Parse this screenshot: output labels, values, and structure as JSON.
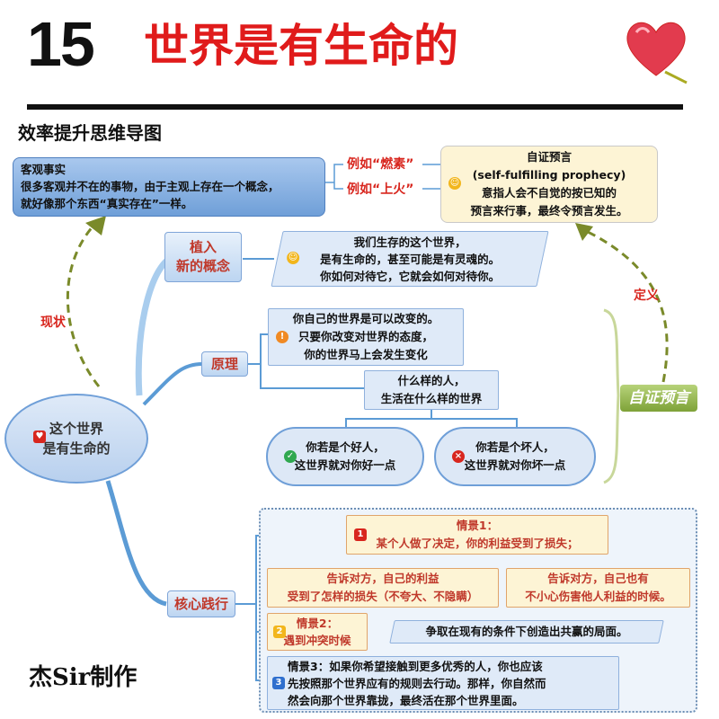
{
  "header": {
    "number": "15",
    "title": "世界是有生命的",
    "subtitle": "效率提升思维导图"
  },
  "footer": {
    "author": "杰Sir制作"
  },
  "center": {
    "line1": "这个世界",
    "line2": "是有生命的"
  },
  "objective_fact": {
    "line1": "客观事实",
    "line2": "很多客观并不在的事物，由于主观上存在一个概念，",
    "line3": "就好像那个东西“真实存在”一样。"
  },
  "examples": {
    "e1": "例如“燃素”",
    "e2": "例如“上火”"
  },
  "self_fulfilling": {
    "line1": "自证预言",
    "line2": "(self-fulfilling prophecy)",
    "line3": "意指人会不自觉的按已知的",
    "line4": "预言来行事，最终令预言发生。"
  },
  "labels": {
    "current": "现状",
    "definition": "定义",
    "self_prophecy": "自证预言"
  },
  "implant": {
    "topic_line1": "植入",
    "topic_line2": "新的概念",
    "line1": "我们生存的这个世界，",
    "line2": "是有生命的，甚至可能是有灵魂的。",
    "line3": "你如何对待它，它就会如何对待你。"
  },
  "principle": {
    "topic": "原理",
    "a1": "你自己的世界是可以改变的。",
    "a2": "只要你改变对世界的态度，",
    "a3": "你的世界马上会发生变化",
    "b1": "什么样的人，",
    "b2": "生活在什么样的世界",
    "good1": "你若是个好人，",
    "good2": "这世界就对你好一点",
    "bad1": "你若是个坏人，",
    "bad2": "这世界就对你坏一点"
  },
  "practice": {
    "topic": "核心践行",
    "s1_title": "情景1：",
    "s1_text": "某个人做了决定，你的利益受到了损失；",
    "s1_a1": "告诉对方，自己的利益",
    "s1_a2": "受到了怎样的损失（不夸大、不隐瞒）",
    "s1_b1": "告诉对方，自己也有",
    "s1_b2": "不小心伤害他人利益的时候。",
    "s2_title": "情景2：",
    "s2_text": "遇到冲突时候",
    "s2_result": "争取在现有的条件下创造出共赢的局面。",
    "s3_line1": "情景3：如果你希望接触到更多优秀的人，你也应该",
    "s3_line2": "先按照那个世界应有的规则去行动。那样，你自然而",
    "s3_line3": "然会向那个世界靠拢，最终活在那个世界里面。",
    "n1": "1",
    "n2": "2",
    "n3": "3"
  },
  "colors": {
    "title_red": "#e01b1b",
    "label_red": "#d8261e",
    "branch_blue": "#5b9bd5",
    "dash_green": "#7a8a2a"
  }
}
